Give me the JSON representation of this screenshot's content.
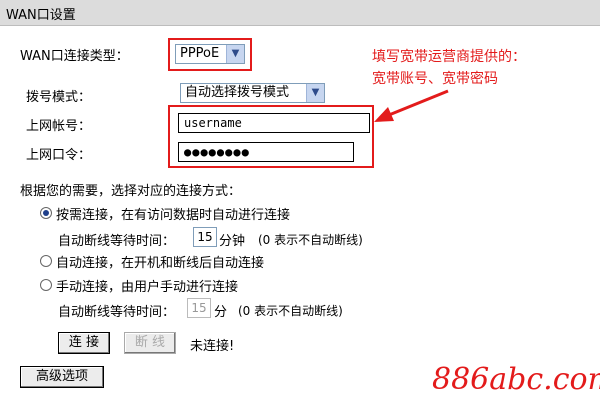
{
  "header": {
    "title": "WAN口设置"
  },
  "form": {
    "connection_type_label": "WAN口连接类型：",
    "connection_type_value": "PPPoE",
    "dial_mode_label": "拨号模式：",
    "dial_mode_value": "自动选择拨号模式",
    "account_label": "上网帐号：",
    "account_value": "username",
    "password_label": "上网口令：",
    "password_value": "●●●●●●●●"
  },
  "annotation": {
    "line1": "填写宽带运营商提供的：",
    "line2": "宽带账号、宽带密码"
  },
  "connection_section": {
    "intro": "根据您的需要，选择对应的连接方式：",
    "options": [
      {
        "label": "按需连接，在有访问数据时自动进行连接",
        "selected": true
      },
      {
        "label": "自动连接，在开机和断线后自动连接",
        "selected": false
      },
      {
        "label": "手动连接，由用户手动进行连接",
        "selected": false
      }
    ],
    "idle1": {
      "label": "自动断线等待时间：",
      "value": "15",
      "unit": "分钟",
      "note": "(0 表示不自动断线)"
    },
    "idle2": {
      "label": "自动断线等待时间：",
      "value": "15",
      "unit": "分",
      "note": "(0 表示不自动断线)"
    }
  },
  "buttons": {
    "connect": "连 接",
    "disconnect": "断 线",
    "status": "未连接!",
    "advanced": "高级选项"
  },
  "watermark": "886abc.com",
  "colors": {
    "annotation_red": "#e31b1b",
    "header_bg": "#dcdcdc"
  }
}
